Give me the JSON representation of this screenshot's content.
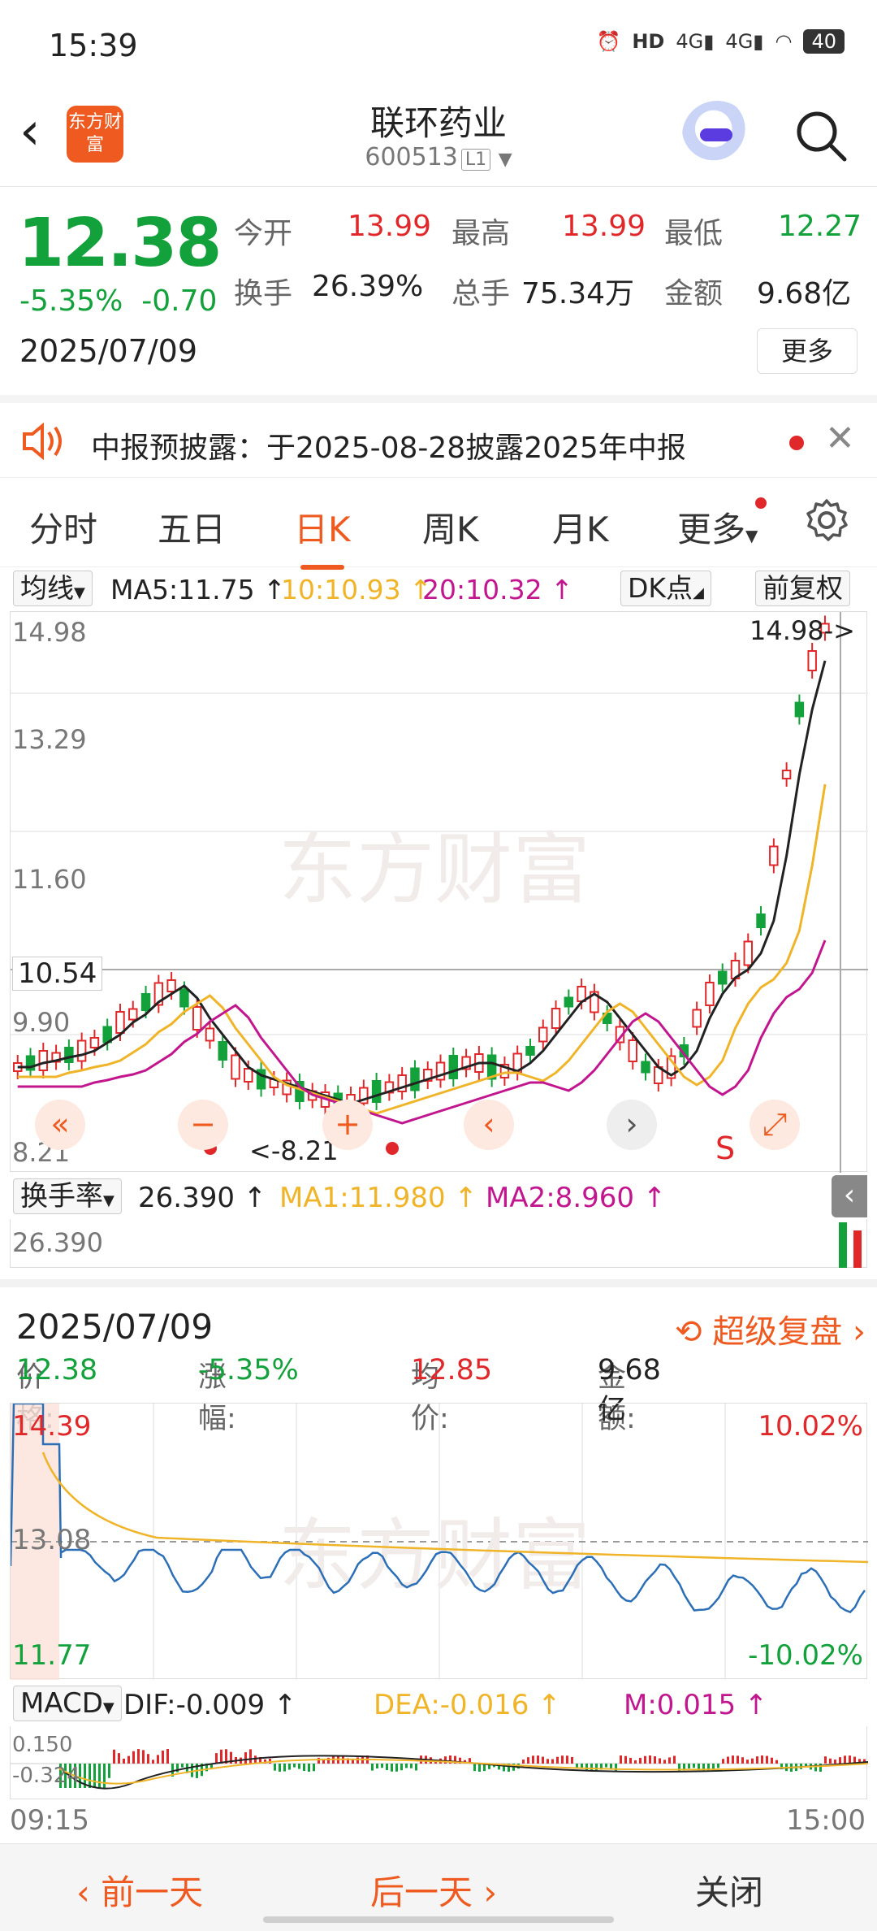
{
  "status": {
    "time": "15:39",
    "icons": [
      "alarm-icon",
      "hd-icon",
      "4g-signal-icon",
      "4g-signal-icon",
      "wifi-icon"
    ],
    "battery": "40"
  },
  "header": {
    "title": "联环药业",
    "code": "600513",
    "level": "L1",
    "logo_text": "东方财富"
  },
  "quote": {
    "price": "12.38",
    "change_pct": "-5.35%",
    "change": "-0.70",
    "date": "2025/07/09",
    "open_label": "今开",
    "open": "13.99",
    "high_label": "最高",
    "high": "13.99",
    "low_label": "最低",
    "low": "12.27",
    "turnover_label": "换手",
    "turnover": "26.39%",
    "volume_label": "总手",
    "volume": "75.34万",
    "amount_label": "金额",
    "amount": "9.68亿",
    "more": "更多"
  },
  "notice": {
    "text": "中报预披露：于2025-08-28披露2025年中报"
  },
  "tabs": [
    "分时",
    "五日",
    "日K",
    "周K",
    "月K",
    "更多"
  ],
  "active_tab": "日K",
  "kbar": {
    "indicator": "均线",
    "ma5": "MA5:11.75 ↑",
    "ma10": "10:10.93 ↑",
    "ma20": "20:10.32 ↑",
    "dk": "DK点",
    "adjust": "前复权"
  },
  "kchart": {
    "y_labels": [
      "14.98",
      "13.29",
      "11.60",
      "9.90",
      "8.21"
    ],
    "crosshair_price": "10.54",
    "max_marker": "14.98->",
    "min_marker": "<-8.21",
    "s_marker": "S",
    "watermark": "东方财富",
    "colors": {
      "up": "#e0282b",
      "down": "#12a13a",
      "ma5": "#222222",
      "ma10": "#f0b429",
      "ma20": "#c2168f"
    }
  },
  "turnover_bar": {
    "indicator": "换手率",
    "value": "26.390 ↑",
    "ma1": "MA1:11.980 ↑",
    "ma2": "MA2:8.960 ↑",
    "y_label": "26.390"
  },
  "intraday": {
    "date": "2025/07/09",
    "replay": "超级复盘",
    "price_label": "价格:",
    "price": "12.38",
    "chg_label": "涨幅:",
    "chg": "-5.35%",
    "avg_label": "均价:",
    "avg": "12.85",
    "amount_label": "金额:",
    "amount": "9.68亿",
    "y_top": "14.39",
    "y_mid": "13.08",
    "y_bottom": "11.77",
    "pct_top": "10.02%",
    "pct_bottom": "-10.02%"
  },
  "macd": {
    "indicator": "MACD",
    "dif": "DIF:-0.009 ↑",
    "dea": "DEA:-0.016 ↑",
    "m": "M:0.015 ↑",
    "y_top": "0.150",
    "y_bottom": "-0.324"
  },
  "time_axis": {
    "start": "09:15",
    "end": "15:00"
  },
  "bottom": {
    "prev": "前一天",
    "next": "后一天",
    "close": "关闭"
  }
}
